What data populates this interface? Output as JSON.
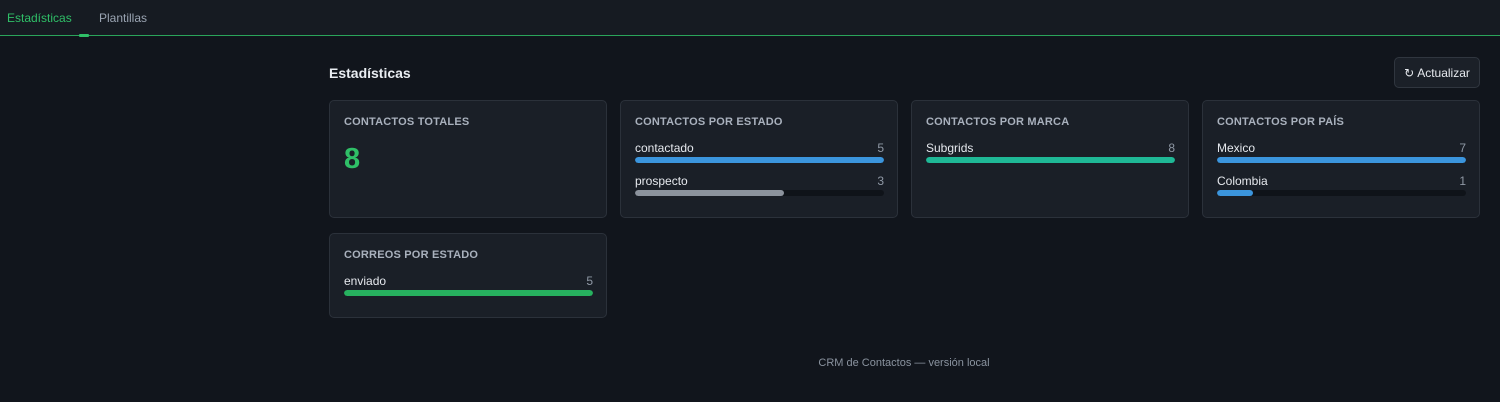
{
  "tabs": [
    {
      "label": "Estadísticas",
      "active": true
    },
    {
      "label": "Plantillas",
      "active": false
    }
  ],
  "page": {
    "title": "Estadísticas"
  },
  "toolbar": {
    "refresh_label": "Actualizar",
    "refresh_icon": "refresh-icon"
  },
  "cards": {
    "total": {
      "title": "CONTACTOS TOTALES",
      "value": "8"
    },
    "by_status": {
      "title": "CONTACTOS POR ESTADO",
      "rows": [
        {
          "label": "contactado",
          "count": "5",
          "fraction": 1.0,
          "color": "#3b95dd"
        },
        {
          "label": "prospecto",
          "count": "3",
          "fraction": 0.6,
          "color": "#8c939d"
        }
      ]
    },
    "by_brand": {
      "title": "CONTACTOS POR MARCA",
      "rows": [
        {
          "label": "Subgrids",
          "count": "8",
          "fraction": 1.0,
          "color": "#1fb896"
        }
      ]
    },
    "by_country": {
      "title": "CONTACTOS POR PAÍS",
      "rows": [
        {
          "label": "Mexico",
          "count": "7",
          "fraction": 1.0,
          "color": "#3b95dd"
        },
        {
          "label": "Colombia",
          "count": "1",
          "fraction": 0.143,
          "color": "#3b95dd"
        }
      ]
    },
    "emails_by_status": {
      "title": "CORREOS POR ESTADO",
      "rows": [
        {
          "label": "enviado",
          "count": "5",
          "fraction": 1.0,
          "color": "#27b15f"
        }
      ]
    }
  },
  "footer": {
    "text": "CRM de Contactos — versión local"
  }
}
